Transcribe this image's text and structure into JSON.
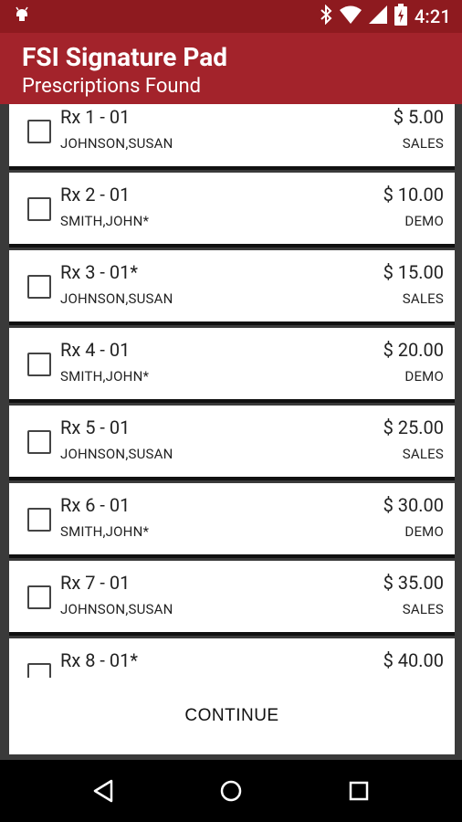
{
  "status_bar": {
    "time": "4:21",
    "icons": [
      "android-icon",
      "bluetooth-icon",
      "wifi-icon",
      "signal-icon",
      "battery-charging-icon"
    ]
  },
  "app_bar": {
    "title": "FSI Signature Pad",
    "subtitle": "Prescriptions Found"
  },
  "prescriptions": [
    {
      "rx": "Rx 1 - 01",
      "name": "JOHNSON,SUSAN",
      "amount": "$ 5.00",
      "type": "SALES"
    },
    {
      "rx": "Rx 2 - 01",
      "name": "SMITH,JOHN*",
      "amount": "$ 10.00",
      "type": "DEMO"
    },
    {
      "rx": "Rx 3 - 01*",
      "name": "JOHNSON,SUSAN",
      "amount": "$ 15.00",
      "type": "SALES"
    },
    {
      "rx": "Rx 4 - 01",
      "name": "SMITH,JOHN*",
      "amount": "$ 20.00",
      "type": "DEMO"
    },
    {
      "rx": "Rx 5 - 01",
      "name": "JOHNSON,SUSAN",
      "amount": "$ 25.00",
      "type": "SALES"
    },
    {
      "rx": "Rx 6 - 01",
      "name": "SMITH,JOHN*",
      "amount": "$ 30.00",
      "type": "DEMO"
    },
    {
      "rx": "Rx 7 - 01",
      "name": "JOHNSON,SUSAN",
      "amount": "$ 35.00",
      "type": "SALES"
    },
    {
      "rx": "Rx 8 - 01*",
      "name": "",
      "amount": "$ 40.00",
      "type": ""
    }
  ],
  "continue_label": "CONTINUE",
  "nav_bar": {
    "icons": [
      "back-icon",
      "home-icon",
      "recents-icon"
    ]
  },
  "colors": {
    "app_bar": "#a3232b",
    "status_bar": "#8e1a1f",
    "list_background": "#3a3a3a"
  }
}
